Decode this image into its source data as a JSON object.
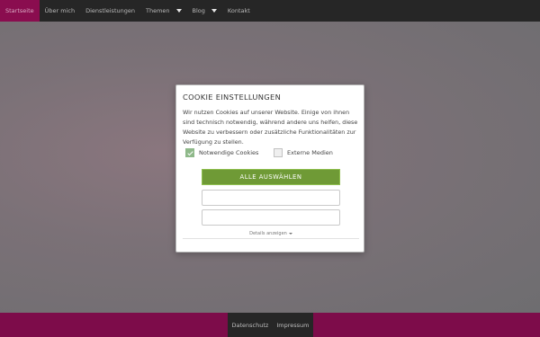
{
  "nav": {
    "items": [
      {
        "label": "Startseite",
        "active": true
      },
      {
        "label": "Über mich"
      },
      {
        "label": "Dienstleistungen"
      },
      {
        "label": "Themen",
        "has_dropdown": true
      },
      {
        "label": "Blog",
        "has_dropdown": true
      },
      {
        "label": "Kontakt"
      }
    ]
  },
  "cookie_modal": {
    "title": "COOKIE EINSTELLUNGEN",
    "description": "Wir nutzen Cookies auf unserer Website. Einige von ihnen sind technisch notwendig, während andere uns helfen, diese Website zu verbessern oder zusätzliche Funktionalitäten zur Verfügung zu stellen.",
    "options": [
      {
        "label": "Notwendige Cookies",
        "checked": true
      },
      {
        "label": "Externe Medien",
        "checked": false
      }
    ],
    "accept_all_label": "ALLE AUSWÄHLEN",
    "button2_label": "",
    "button3_label": "",
    "details_label": "Details anzeigen"
  },
  "footer": {
    "links": [
      "Datenschutz",
      "Impressum"
    ]
  },
  "colors": {
    "brand_magenta": "#8a0d4f",
    "nav_bg": "#262626",
    "accept_green": "#6f9a36",
    "checkbox_green": "#8fb98a"
  },
  "icons": {
    "dropdown": "caret-down-icon",
    "checkbox_checked": "checkmark-icon"
  }
}
